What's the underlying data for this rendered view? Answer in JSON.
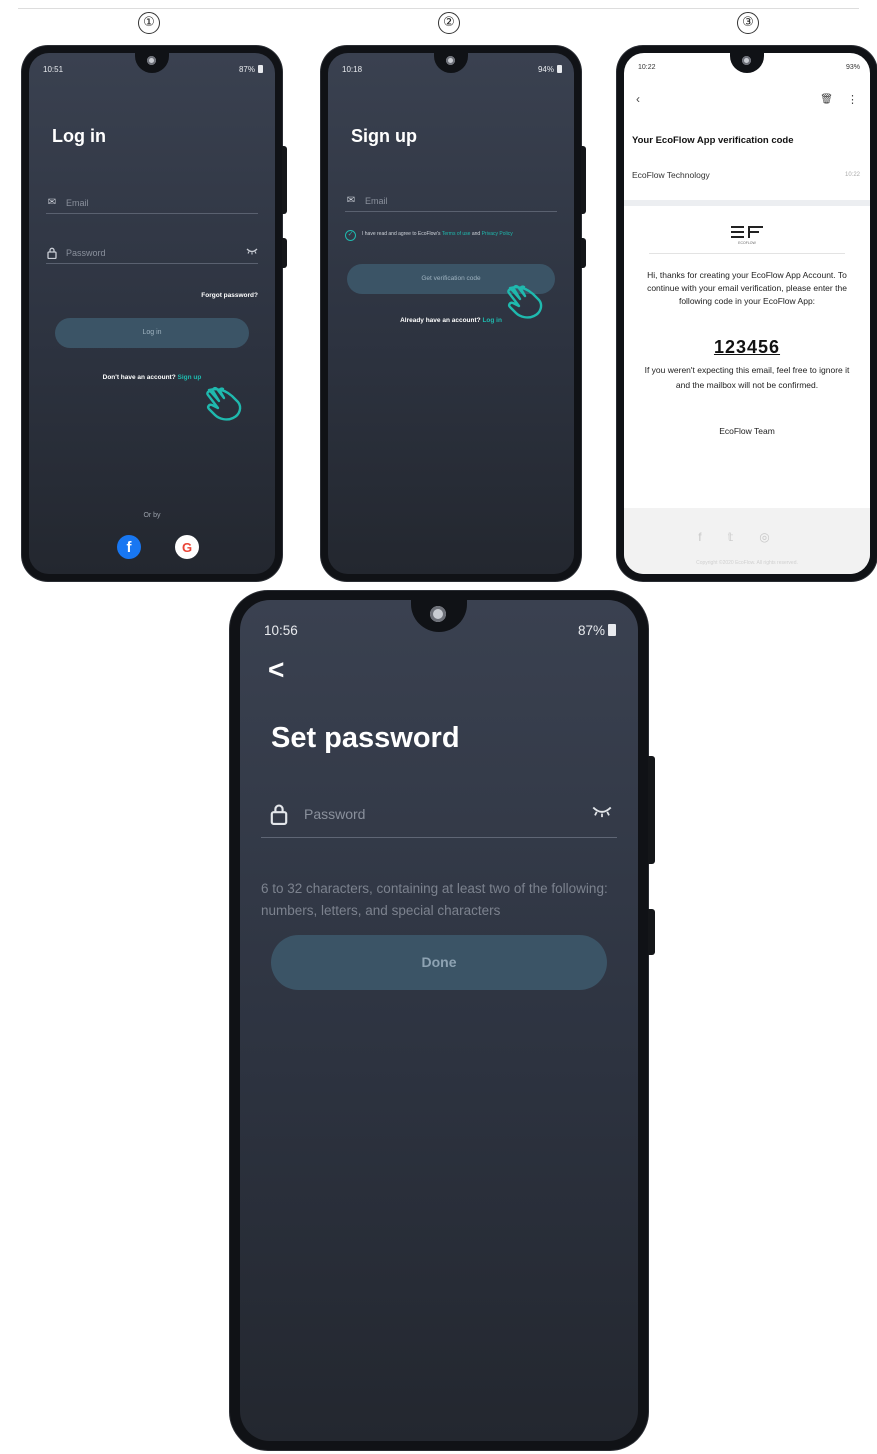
{
  "step_labels": [
    "①",
    "②",
    "③"
  ],
  "colors": {
    "accent": "#1fb9ae",
    "button_bg": "#3b5466",
    "screen_bg": "#2d3340"
  },
  "screen1": {
    "status_time": "10:51",
    "status_right": "87%",
    "title": "Log in",
    "email_placeholder": "Email",
    "password_placeholder": "Password",
    "forgot_password": "Forgot password?",
    "login_button": "Log in",
    "no_account": "Don't have an account?",
    "signup_link": "Sign up",
    "or_by": "Or by"
  },
  "screen2": {
    "status_time": "10:18",
    "status_right": "94%",
    "title": "Sign up",
    "email_placeholder": "Email",
    "agree_text": "I have read and agree to EcoFlow's",
    "terms_link": "Terms of use",
    "and_text": "and",
    "privacy_link": "Privacy Policy",
    "verification_button": "Get verification code",
    "have_account": "Already have an account?",
    "login_link": "Log in"
  },
  "screen3": {
    "status_time": "10:22",
    "status_right": "93%",
    "subject": "Your EcoFlow App verification code",
    "sender": "EcoFlow Technology",
    "time_label": "10:22",
    "logo_text": "ECOFLOW",
    "body_text": "Hi, thanks for creating your EcoFlow App Account. To continue with your email verification, please enter the following code in your EcoFlow App:",
    "code": "123456",
    "body_text2": "If you weren't expecting this email, feel free to ignore it and the mailbox will not be confirmed.",
    "team": "EcoFlow Team",
    "copyright": "Copyright ©2020 EcoFlow. All rights reserved."
  },
  "screen4": {
    "status_time": "10:56",
    "status_right": "87%",
    "back_glyph": "<",
    "title": "Set password",
    "password_placeholder": "Password",
    "hint": "6 to 32 characters, containing at least two of the following: numbers, letters, and special characters",
    "done_button": "Done"
  }
}
